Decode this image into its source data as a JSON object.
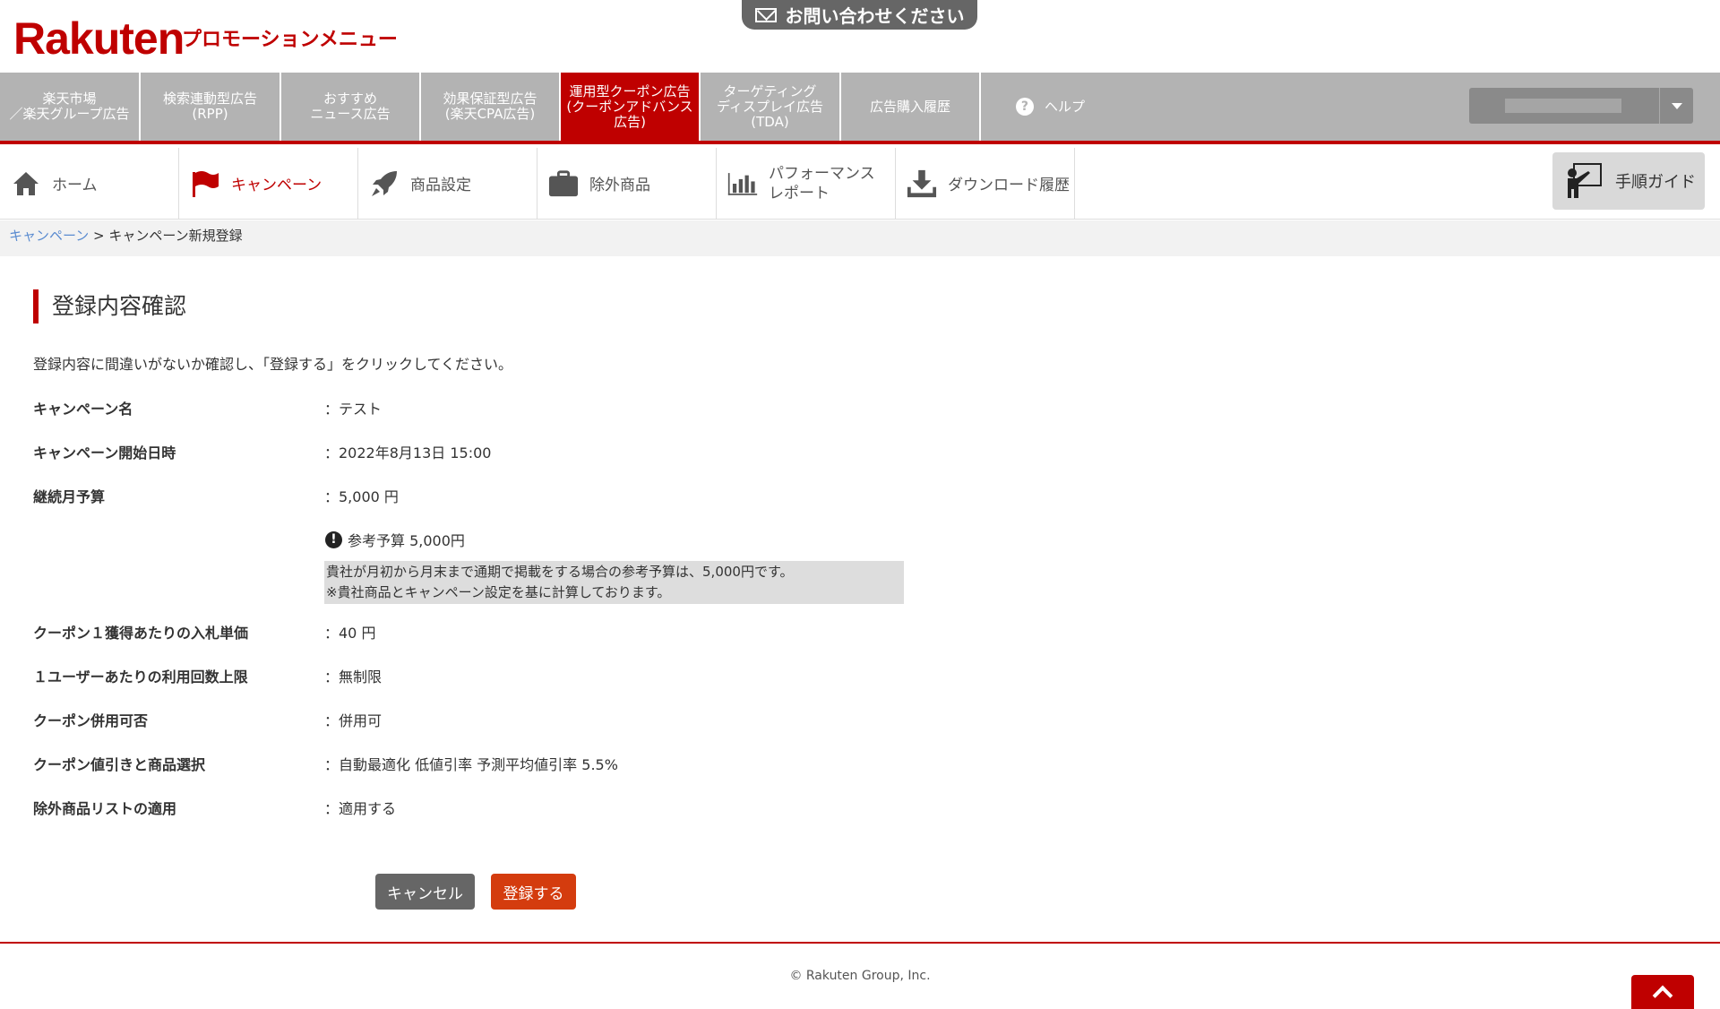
{
  "header": {
    "logo": "Rakuten",
    "subtitle": "プロモーションメニュー",
    "contact_label": "お問い合わせください"
  },
  "topnav": {
    "items": [
      {
        "label": "楽天市場\n／楽天グループ広告"
      },
      {
        "label": "検索連動型広告\n(RPP)"
      },
      {
        "label": "おすすめ\nニュース広告"
      },
      {
        "label": "効果保証型広告\n(楽天CPA広告)"
      },
      {
        "label": "運用型クーポン広告\n(クーポンアドバンス\n広告)"
      },
      {
        "label": "ターゲティング\nディスプレイ広告\n(TDA)"
      },
      {
        "label": "広告購入履歴"
      },
      {
        "label": "ヘルプ"
      }
    ],
    "active_index": 4
  },
  "subnav": {
    "items": [
      {
        "label": "ホーム",
        "icon": "home-icon"
      },
      {
        "label": "キャンペーン",
        "icon": "flag-icon"
      },
      {
        "label": "商品設定",
        "icon": "rocket-icon"
      },
      {
        "label": "除外商品",
        "icon": "briefcase-icon"
      },
      {
        "label": "パフォーマンス\nレポート",
        "icon": "bar-chart-icon"
      },
      {
        "label": "ダウンロード履歴",
        "icon": "download-icon"
      }
    ],
    "guide_label": "手順ガイド"
  },
  "breadcrumb": {
    "link": "キャンペーン",
    "separator": ">",
    "current": "キャンペーン新規登録"
  },
  "main": {
    "title": "登録内容確認",
    "intro": "登録内容に間違いがないか確認し、「登録する」をクリックしてください。",
    "rows": [
      {
        "label": "キャンペーン名",
        "value": "：テスト"
      },
      {
        "label": "キャンペーン開始日時",
        "value": "：2022年8月13日 15:00"
      },
      {
        "label": "継続月予算",
        "value": "：5,000 円"
      },
      {
        "label": "クーポン１獲得あたりの入札単価",
        "value": "：40 円"
      },
      {
        "label": "１ユーザーあたりの利用回数上限",
        "value": "：無制限"
      },
      {
        "label": "クーポン併用可否",
        "value": "：併用可"
      },
      {
        "label": "クーポン値引きと商品選択",
        "value": "：自動最適化 低値引率 予測平均値引率 5.5%"
      },
      {
        "label": "除外商品リストの適用",
        "value": "：適用する"
      }
    ],
    "notice": {
      "title": "参考予算 5,000円",
      "line1": "貴社が月初から月末まで通期で掲載をする場合の参考予算は、5,000円です。",
      "line2": "※貴社商品とキャンペーン設定を基に計算しております。"
    },
    "cancel_label": "キャンセル",
    "submit_label": "登録する"
  },
  "footer": {
    "copyright": "© Rakuten Group, Inc."
  },
  "colors": {
    "brand": "#bf0000",
    "nav_gray": "#b3b3b3",
    "submit": "#d43c0e",
    "cancel": "#666666"
  }
}
